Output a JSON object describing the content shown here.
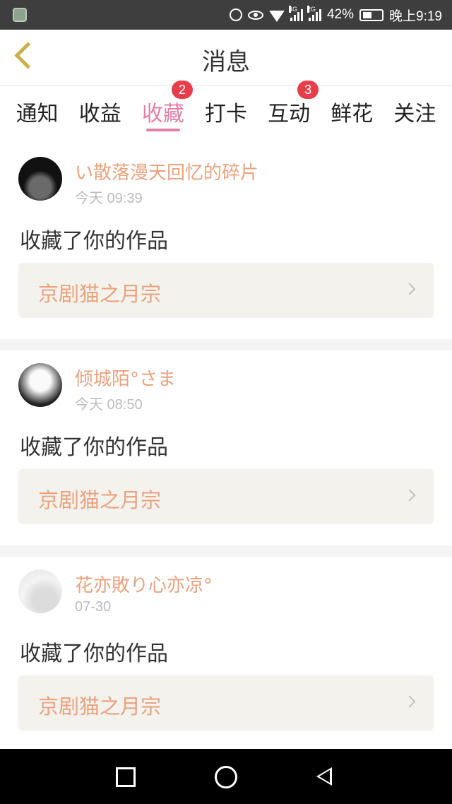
{
  "status_bar": {
    "network_4g": "4G",
    "network_2g": "2G",
    "battery": "42%",
    "time": "晚上9:19"
  },
  "header": {
    "title": "消息"
  },
  "tabs": [
    {
      "label": "通知",
      "badge": ""
    },
    {
      "label": "收益",
      "badge": ""
    },
    {
      "label": "收藏",
      "badge": "2",
      "active": true
    },
    {
      "label": "打卡",
      "badge": ""
    },
    {
      "label": "互动",
      "badge": "3"
    },
    {
      "label": "鲜花",
      "badge": ""
    },
    {
      "label": "关注",
      "badge": ""
    }
  ],
  "feed": [
    {
      "user": "い散落漫天回忆的碎片",
      "time": "今天 09:39",
      "action": "收藏了你的作品",
      "work": "京剧猫之月宗"
    },
    {
      "user": "倾城陌°さま",
      "time": "今天 08:50",
      "action": "收藏了你的作品",
      "work": "京剧猫之月宗"
    },
    {
      "user": "花亦敗り心亦凉°",
      "time": "07-30",
      "action": "收藏了你的作品",
      "work": "京剧猫之月宗"
    }
  ],
  "colors": {
    "accent_pink": "#e27fa6",
    "username_orange": "#eaa27f",
    "badge_red": "#e83e4b",
    "back_arrow_gold": "#c8b04a"
  }
}
